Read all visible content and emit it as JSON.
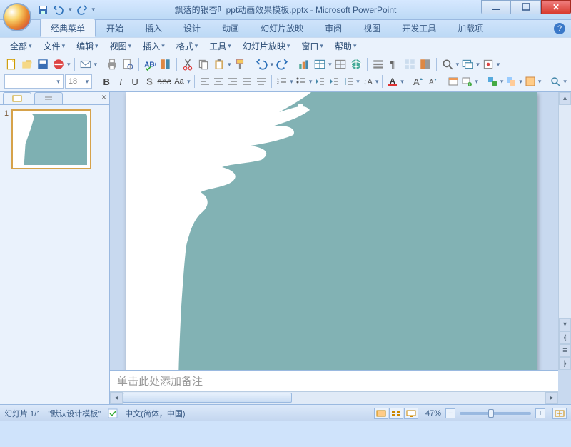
{
  "window": {
    "title": "飘落的银杏叶ppt动画效果模板.pptx - Microsoft PowerPoint"
  },
  "ribbon_tabs": [
    "经典菜单",
    "开始",
    "插入",
    "设计",
    "动画",
    "幻灯片放映",
    "审阅",
    "视图",
    "开发工具",
    "加载项"
  ],
  "active_tab_index": 0,
  "classic_menu": [
    "全部",
    "文件",
    "编辑",
    "视图",
    "插入",
    "格式",
    "工具",
    "幻灯片放映",
    "窗口",
    "帮助"
  ],
  "font": {
    "name": "",
    "size": "18"
  },
  "thumbs": {
    "slide_num": "1"
  },
  "notes": {
    "placeholder": "单击此处添加备注"
  },
  "status": {
    "slide_pos": "幻灯片 1/1",
    "template": "\"默认设计模板\"",
    "lang": "中文(简体，中国)",
    "zoom": "47%"
  }
}
